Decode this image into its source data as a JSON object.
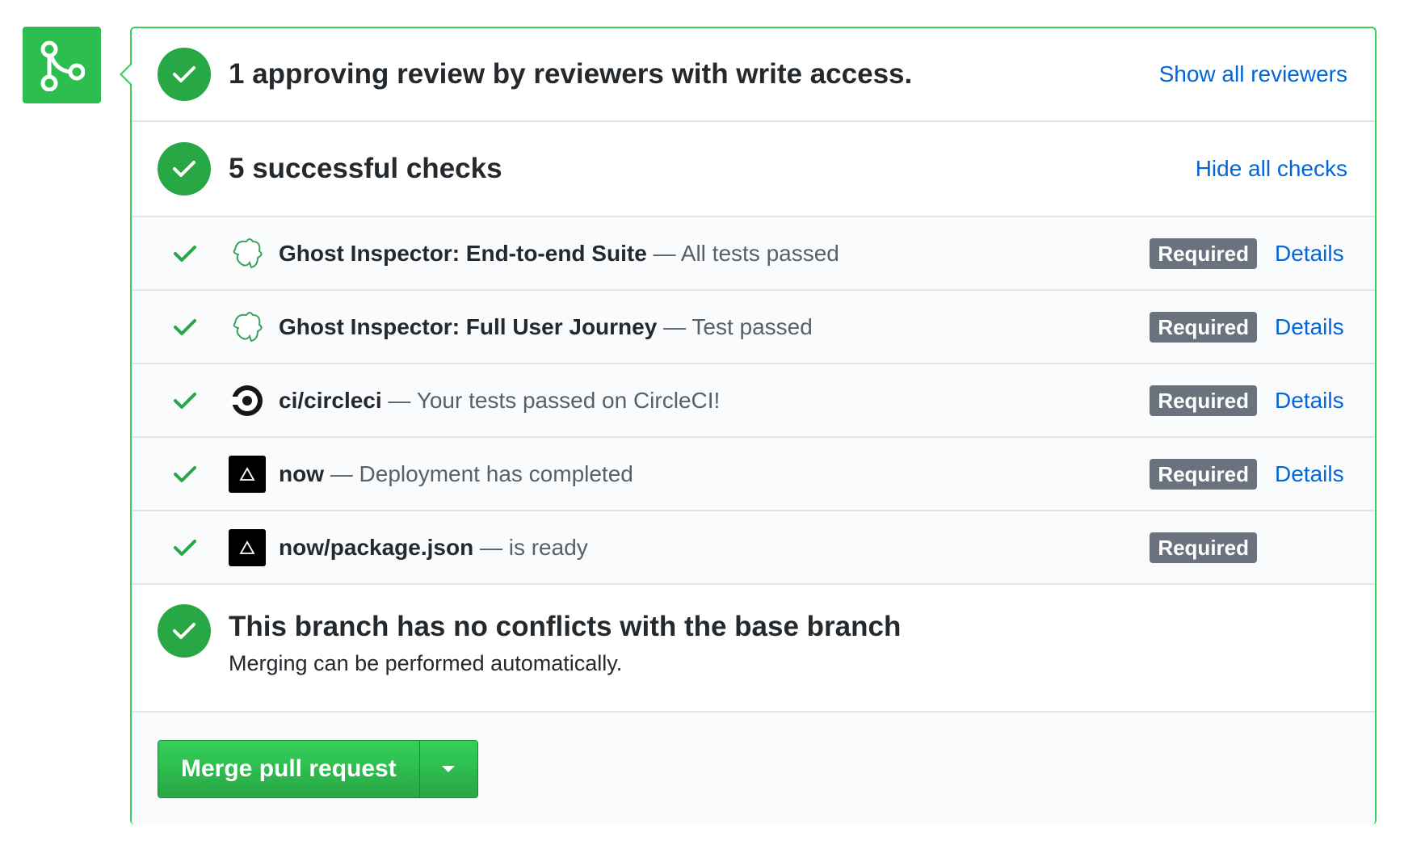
{
  "colors": {
    "success_green": "#28a745",
    "border_green": "#34d058",
    "link_blue": "#0366d6",
    "badge_gray": "#6a737d"
  },
  "merge_icon": "git-merge-icon",
  "review": {
    "icon": "check-circle-icon",
    "title": "1 approving review by reviewers with write access.",
    "link": "Show all reviewers"
  },
  "checks": {
    "icon": "check-circle-icon",
    "title": "5 successful checks",
    "link": "Hide all checks",
    "items": [
      {
        "avatar": "ghost-inspector-icon",
        "name": "Ghost Inspector: End-to-end Suite",
        "description": " — All tests passed",
        "badge": "Required",
        "details": "Details"
      },
      {
        "avatar": "ghost-inspector-icon",
        "name": "Ghost Inspector: Full User Journey",
        "description": " — Test passed",
        "badge": "Required",
        "details": "Details"
      },
      {
        "avatar": "circleci-icon",
        "name": "ci/circleci",
        "description": " — Your tests passed on CircleCI!",
        "badge": "Required",
        "details": "Details"
      },
      {
        "avatar": "now-icon",
        "name": "now",
        "description": " — Deployment has completed",
        "badge": "Required",
        "details": "Details"
      },
      {
        "avatar": "now-icon",
        "name": "now/package.json",
        "description": " — is ready",
        "badge": "Required",
        "details": ""
      }
    ]
  },
  "branch": {
    "icon": "check-circle-icon",
    "title": "This branch has no conflicts with the base branch",
    "subtitle": "Merging can be performed automatically."
  },
  "actions": {
    "merge_button": "Merge pull request",
    "dropdown_icon": "caret-down-icon"
  }
}
